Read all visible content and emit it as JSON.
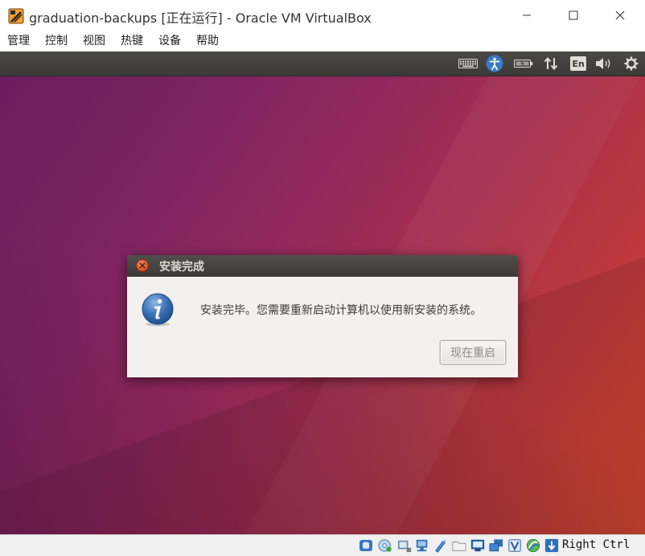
{
  "window": {
    "title": "graduation-backups [正在运行] - Oracle VM VirtualBox"
  },
  "menubar": {
    "items": [
      {
        "label": "管理"
      },
      {
        "label": "控制"
      },
      {
        "label": "视图"
      },
      {
        "label": "热键"
      },
      {
        "label": "设备"
      },
      {
        "label": "帮助"
      }
    ]
  },
  "panel": {
    "keyboard_layout": "En"
  },
  "dialog": {
    "title": "安装完成",
    "message": "安装完毕。您需要重新启动计算机以使用新安装的系统。",
    "restart_label": "现在重启"
  },
  "statusbar": {
    "host_key": "Right Ctrl"
  },
  "colors": {
    "panel_bg": "#3c3b37",
    "close_orange": "#df5a2b",
    "dialog_bg": "#f2f1f0",
    "info_blue": "#3d72b8"
  }
}
